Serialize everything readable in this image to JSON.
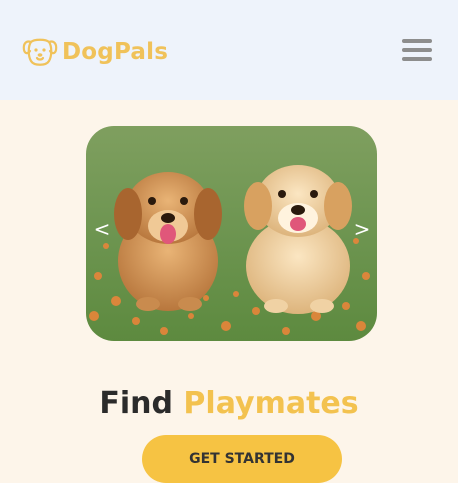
{
  "brand": {
    "name": "DogPals",
    "logo_icon": "dog-face-icon",
    "color": "#f0c25a"
  },
  "nav": {
    "menu_icon": "hamburger-menu-icon"
  },
  "carousel": {
    "image": "two golden retriever puppies sitting in grass with orange flowers",
    "prev_label": "<",
    "next_label": ">"
  },
  "hero": {
    "title_part1": "Find",
    "title_part2": "Playmates",
    "accent": "#f3c24f"
  },
  "cta": {
    "label": "GET STARTED",
    "color": "#f6c343"
  }
}
